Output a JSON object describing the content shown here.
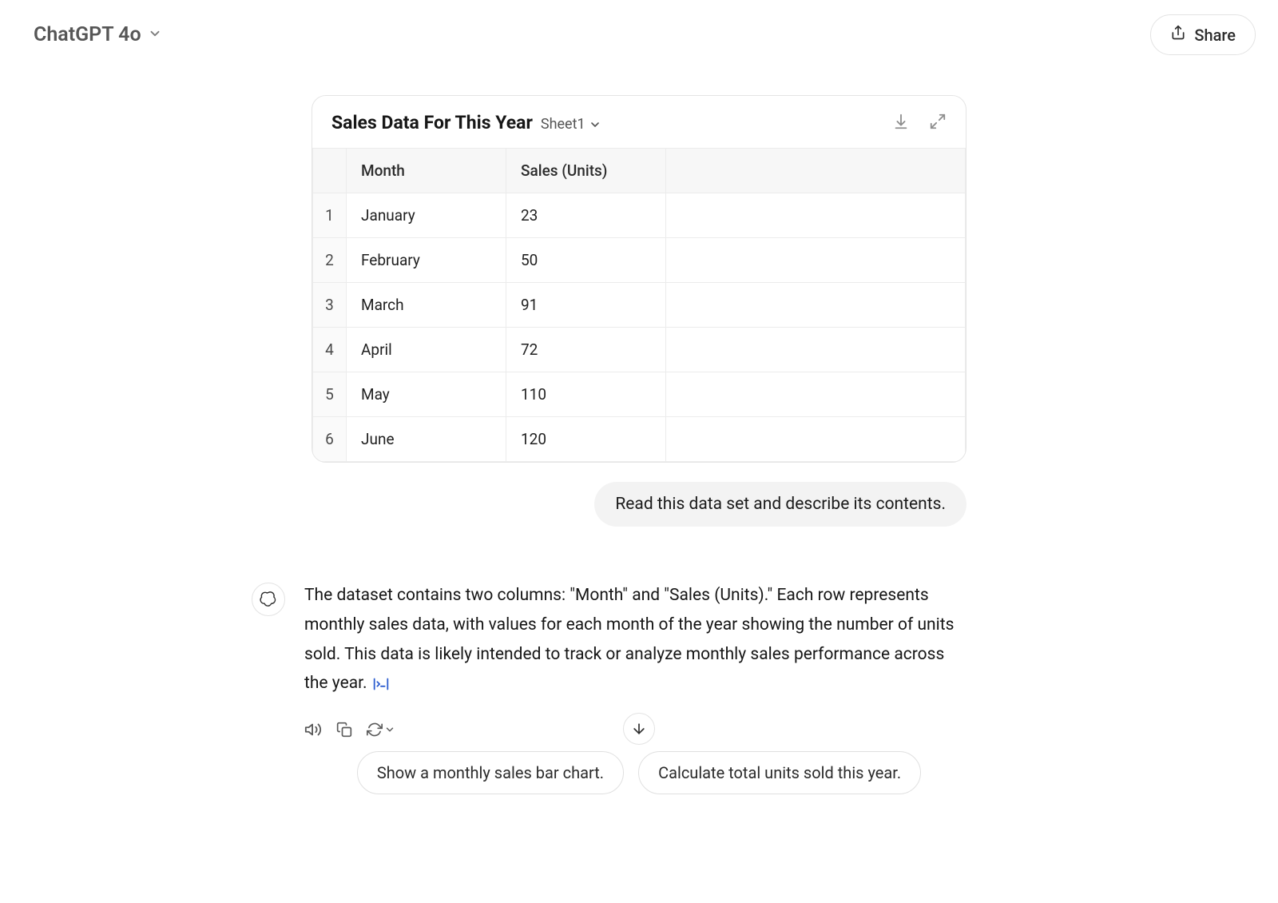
{
  "header": {
    "model_label": "ChatGPT 4o",
    "share_label": "Share"
  },
  "sheet": {
    "title": "Sales Data For This Year",
    "tab": "Sheet1",
    "columns": [
      "Month",
      "Sales (Units)"
    ],
    "rows": [
      {
        "n": "1",
        "month": "January",
        "sales": "23"
      },
      {
        "n": "2",
        "month": "February",
        "sales": "50"
      },
      {
        "n": "3",
        "month": "March",
        "sales": "91"
      },
      {
        "n": "4",
        "month": "April",
        "sales": "72"
      },
      {
        "n": "5",
        "month": "May",
        "sales": "110"
      },
      {
        "n": "6",
        "month": "June",
        "sales": "120"
      }
    ]
  },
  "user_message": "Read this data set and describe its contents.",
  "assistant_message": "The dataset contains two columns: \"Month\" and \"Sales (Units).\" Each row represents monthly sales data, with values for each month of the year showing the number of units sold. This data is likely intended to track or analyze monthly sales performance across the year.",
  "suggestions": [
    "Show a monthly sales bar chart.",
    "Calculate total units sold this year."
  ]
}
